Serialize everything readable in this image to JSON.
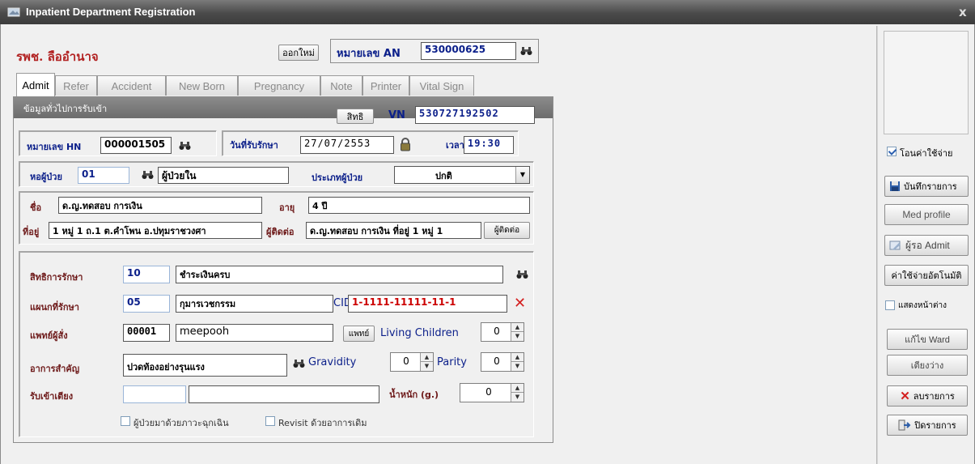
{
  "window": {
    "title": "Inpatient Department Registration",
    "close_glyph": "x"
  },
  "header": {
    "hospital": "รพช. ลืออำนาจ",
    "new_button": "ออกใหม่",
    "an_label": "หมายเลข AN",
    "an_value": "530000625"
  },
  "tabs": [
    "Admit",
    "Refer",
    "Accident",
    "New Born",
    "Pregnancy",
    "Note",
    "Printer",
    "Vital Sign"
  ],
  "panel": {
    "title": "ข้อมูลทั่วไปการรับเข้า",
    "rights_button": "สิทธิ",
    "vn_label": "VN",
    "vn_value": "530727192502"
  },
  "hn": {
    "label": "หมายเลข HN",
    "value": "000001505"
  },
  "admit_date": {
    "label": "วันที่รับรักษา",
    "value": "27/07/2553",
    "time_label": "เวลา",
    "time_value": "19:30"
  },
  "ward": {
    "label": "หอผู้ป่วย",
    "code": "01",
    "name": "ผู้ป่วยใน",
    "type_label": "ประเภทผู้ป่วย",
    "type_value": "ปกติ"
  },
  "patient": {
    "name_label": "ชื่อ",
    "name": "ด.ญ.ทดสอบ การเงิน",
    "age_label": "อายุ",
    "age": "4 ปี",
    "address_label": "ที่อยู่",
    "address": "1 หมู่ 1 ถ.1 ต.คำโพน อ.ปทุมราชวงศา",
    "contact_label": "ผู้ติดต่อ",
    "contact": "ด.ญ.ทดสอบ การเงิน ที่อยู่ 1 หมู่ 1",
    "contact_button": "ผู้ติดต่อ"
  },
  "treatment": {
    "rights_label": "สิทธิการรักษา",
    "rights_code": "10",
    "rights_name": "ชำระเงินครบ",
    "dept_label": "แผนกที่รักษา",
    "dept_code": "05",
    "dept_name": "กุมารเวชกรรม",
    "cid_label": "CID",
    "cid_value": "1-1111-11111-11-1",
    "doctor_label": "แพทย์ผู้สั่ง",
    "doctor_code": "00001",
    "doctor_name": "meepooh",
    "doctor_button": "แพทย์",
    "living_children_label": "Living Children",
    "living_children": "0",
    "symptom_label": "อาการสำคัญ",
    "symptom": "ปวดท้องอย่างรุนแรง",
    "gravidity_label": "Gravidity",
    "gravidity": "0",
    "parity_label": "Parity",
    "parity": "0",
    "bed_label": "รับเข้าเตียง",
    "bed_code": "",
    "bed_name": "",
    "weight_label": "น้ำหนัก (g.)",
    "weight": "0",
    "emergency_label": "ผู้ป่วยมาด้วยภาวะฉุกเฉิน",
    "revisit_label": "Revisit ด้วยอาการเดิม"
  },
  "sidebar": {
    "transfer_cost_label": "โอนค่าใช้จ่าย",
    "save": "บันทึกรายการ",
    "med_profile": "Med profile",
    "waiting_admit": "ผู้รอ Admit",
    "auto_cost": "ค่าใช้จ่ายอัตโนมัติ",
    "show_window": "แสดงหน้าต่าง",
    "edit_ward": "แก้ไข Ward",
    "empty_bed": "เตียงว่าง",
    "delete": "ลบรายการ",
    "close": "ปิดรายการ"
  }
}
